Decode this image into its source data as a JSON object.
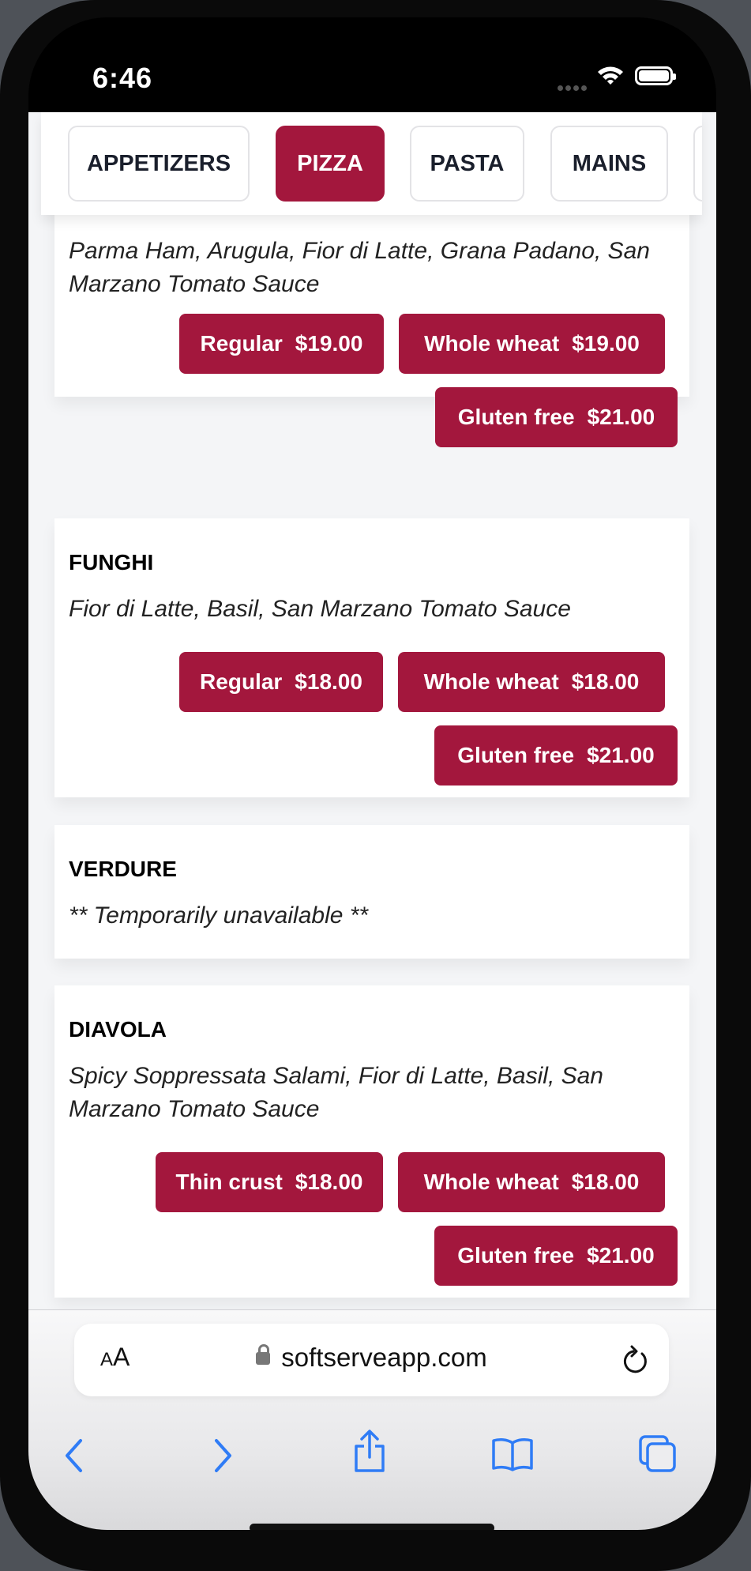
{
  "status_bar": {
    "time": "6:46"
  },
  "tabs": [
    {
      "label": "APPETIZERS",
      "active": false
    },
    {
      "label": "PIZZA",
      "active": true
    },
    {
      "label": "PASTA",
      "active": false
    },
    {
      "label": "MAINS",
      "active": false
    }
  ],
  "items": [
    {
      "name": "",
      "description": "Parma Ham, Arugula, Fior di Latte, Grana Padano, San Marzano Tomato Sauce",
      "prices": [
        {
          "label": "Regular",
          "price": "$19.00"
        },
        {
          "label": "Whole wheat",
          "price": "$19.00"
        },
        {
          "label": "Gluten free",
          "price": "$21.00"
        }
      ]
    },
    {
      "name": "FUNGHI",
      "description": "Fior di Latte, Basil, San Marzano Tomato Sauce",
      "prices": [
        {
          "label": "Regular",
          "price": "$18.00"
        },
        {
          "label": "Whole wheat",
          "price": "$18.00"
        },
        {
          "label": "Gluten free",
          "price": "$21.00"
        }
      ]
    },
    {
      "name": "VERDURE",
      "description": "** Temporarily unavailable **",
      "prices": []
    },
    {
      "name": "DIAVOLA",
      "description": "Spicy Soppressata Salami, Fior di Latte, Basil, San Marzano Tomato Sauce",
      "prices": [
        {
          "label": "Thin crust",
          "price": "$18.00"
        },
        {
          "label": "Whole wheat",
          "price": "$18.00"
        },
        {
          "label": "Gluten free",
          "price": "$21.00"
        }
      ]
    }
  ],
  "browser": {
    "text_size_label_small": "A",
    "text_size_label_large": "A",
    "url": "softserveapp.com"
  },
  "colors": {
    "accent": "#a3173d",
    "safari_blue": "#2f7cf6"
  }
}
